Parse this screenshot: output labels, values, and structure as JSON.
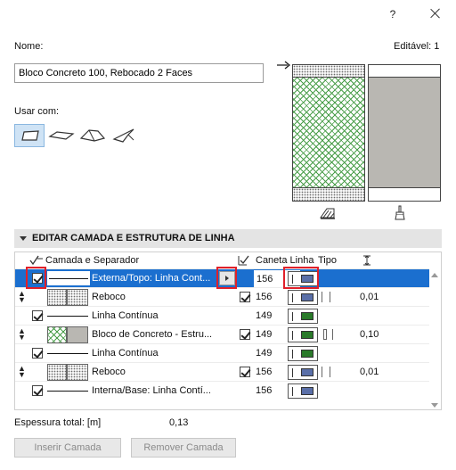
{
  "titlebar": {
    "help_label": "?"
  },
  "name": {
    "label": "Nome:",
    "value": "Bloco Concreto 100, Rebocado 2 Faces"
  },
  "editable": {
    "label": "Editável: 1"
  },
  "use_with": {
    "label": "Usar com:",
    "options": [
      "wall",
      "slab",
      "roof",
      "shell"
    ],
    "selected": "wall"
  },
  "section": {
    "title": "EDITAR CAMADA E ESTRUTURA DE LINHA"
  },
  "table": {
    "headers": {
      "layer": "Camada e Separador",
      "pen": "Caneta Linha",
      "type": "Tipo"
    },
    "rows": [
      {
        "kind": "line",
        "checked": true,
        "name": "Externa/Topo: Linha Cont...",
        "pen": "156",
        "pen_color": "#5a6fa8",
        "selected": true
      },
      {
        "kind": "layer",
        "pattern": "dots",
        "name": "Reboco",
        "checked": true,
        "pen": "156",
        "pen_color": "#5a6fa8",
        "thickness": "0,01"
      },
      {
        "kind": "line",
        "checked": true,
        "name": "Linha Contínua",
        "pen": "149",
        "pen_color": "#2a7a2a"
      },
      {
        "kind": "layer",
        "pattern": "hatch",
        "name": "Bloco de Concreto - Estru...",
        "checked": true,
        "pen": "149",
        "pen_color": "#2a7a2a",
        "thickness": "0,10"
      },
      {
        "kind": "line",
        "checked": true,
        "name": "Linha Contínua",
        "pen": "149",
        "pen_color": "#2a7a2a"
      },
      {
        "kind": "layer",
        "pattern": "dots",
        "name": "Reboco",
        "checked": true,
        "pen": "156",
        "pen_color": "#5a6fa8",
        "thickness": "0,01"
      },
      {
        "kind": "line",
        "checked": true,
        "name": "Interna/Base: Linha Contí...",
        "pen": "156",
        "pen_color": "#5a6fa8"
      }
    ]
  },
  "total": {
    "label": "Espessura total: [m]",
    "value": "0,13"
  },
  "buttons": {
    "insert": "Inserir Camada",
    "remove": "Remover Camada"
  },
  "colors": {
    "selection": "#1b6fcf",
    "highlight_box": "#e0202a",
    "hatch": "#4a9e4a"
  }
}
